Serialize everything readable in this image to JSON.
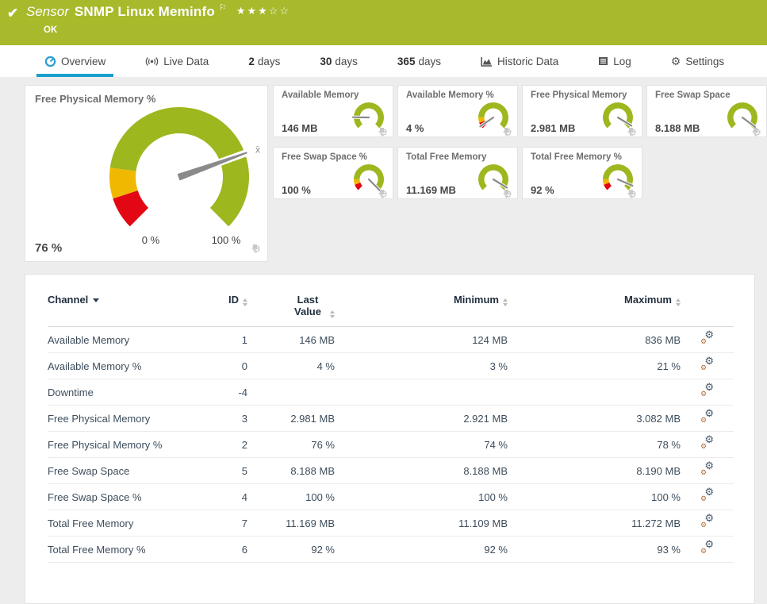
{
  "colors": {
    "header_bg": "#a8b92b",
    "accent_blue": "#189fcd",
    "gauge_green": "#9db71e",
    "gauge_yellow": "#f0b800",
    "gauge_red": "#e30613",
    "needle_gray": "#8a8a8a"
  },
  "header": {
    "check": "✔",
    "kind": "Sensor",
    "title": "SNMP Linux Meminfo",
    "flag": "⚐",
    "rating": {
      "filled": 3,
      "total": 5
    },
    "status": "OK"
  },
  "tabs": [
    {
      "bold": "",
      "label": "Overview",
      "icon": "gauge-icon",
      "active": true
    },
    {
      "bold": "",
      "label": "Live Data",
      "icon": "broadcast-icon",
      "active": false
    },
    {
      "bold": "2",
      "label": "days",
      "icon": "",
      "active": false
    },
    {
      "bold": "30",
      "label": "days",
      "icon": "",
      "active": false
    },
    {
      "bold": "365",
      "label": "days",
      "icon": "",
      "active": false
    },
    {
      "bold": "",
      "label": "Historic Data",
      "icon": "area-chart-icon",
      "active": false
    },
    {
      "bold": "",
      "label": "Log",
      "icon": "log-icon",
      "active": false
    },
    {
      "bold": "",
      "label": "Settings",
      "icon": "gear-icon",
      "active": false
    }
  ],
  "chart_data": {
    "type": "gauge-set",
    "segment_presets": {
      "main": [
        {
          "to": 0.1,
          "color": "#e30613"
        },
        {
          "to": 0.195,
          "color": "#f0b800"
        },
        {
          "to": 1,
          "color": "#9db71e"
        }
      ],
      "percent": [
        {
          "to": 0.09,
          "color": "#e30613"
        },
        {
          "to": 0.17,
          "color": "#f0b800"
        },
        {
          "to": 1,
          "color": "#9db71e"
        }
      ],
      "level": [
        {
          "to": 1,
          "color": "#9db71e"
        }
      ]
    },
    "main": {
      "title": "Free Physical Memory %",
      "value_label": "76 %",
      "scale_min_label": "0 %",
      "scale_max_label": "100 %",
      "fraction": 0.76,
      "avg_marker": "x̄",
      "preset": "main"
    },
    "small": [
      {
        "title": "Available Memory",
        "value_label": "146 MB",
        "fraction": 0.17,
        "preset": "level"
      },
      {
        "title": "Available Memory %",
        "value_label": "4 %",
        "fraction": 0.04,
        "preset": "percent"
      },
      {
        "title": "Free Physical Memory",
        "value_label": "2.981 MB",
        "fraction": 0.95,
        "preset": "level"
      },
      {
        "title": "Free Swap Space",
        "value_label": "8.188 MB",
        "fraction": 0.97,
        "preset": "level"
      },
      {
        "title": "Free Swap Space %",
        "value_label": "100 %",
        "fraction": 1.0,
        "preset": "percent"
      },
      {
        "title": "Total Free Memory",
        "value_label": "11.169 MB",
        "fraction": 0.95,
        "preset": "level"
      },
      {
        "title": "Total Free Memory %",
        "value_label": "92 %",
        "fraction": 0.92,
        "preset": "percent"
      }
    ]
  },
  "table": {
    "columns": [
      {
        "label": "Channel",
        "sort": "active"
      },
      {
        "label": "ID",
        "sort": "sortable"
      },
      {
        "label": "Last Value",
        "sort": "sortable"
      },
      {
        "label": "Minimum",
        "sort": "sortable"
      },
      {
        "label": "Maximum",
        "sort": "sortable"
      },
      {
        "label": "",
        "sort": "none"
      }
    ],
    "rows": [
      {
        "channel": "Available Memory",
        "id": "1",
        "last": "146 MB",
        "min": "124 MB",
        "max": "836 MB"
      },
      {
        "channel": "Available Memory %",
        "id": "0",
        "last": "4 %",
        "min": "3 %",
        "max": "21 %"
      },
      {
        "channel": "Downtime",
        "id": "-4",
        "last": "",
        "min": "",
        "max": ""
      },
      {
        "channel": "Free Physical Memory",
        "id": "3",
        "last": "2.981 MB",
        "min": "2.921 MB",
        "max": "3.082 MB"
      },
      {
        "channel": "Free Physical Memory %",
        "id": "2",
        "last": "76 %",
        "min": "74 %",
        "max": "78 %"
      },
      {
        "channel": "Free Swap Space",
        "id": "5",
        "last": "8.188 MB",
        "min": "8.188 MB",
        "max": "8.190 MB"
      },
      {
        "channel": "Free Swap Space %",
        "id": "4",
        "last": "100 %",
        "min": "100 %",
        "max": "100 %"
      },
      {
        "channel": "Total Free Memory",
        "id": "7",
        "last": "11.169 MB",
        "min": "11.109 MB",
        "max": "11.272 MB"
      },
      {
        "channel": "Total Free Memory %",
        "id": "6",
        "last": "92 %",
        "min": "92 %",
        "max": "93 %"
      }
    ]
  }
}
